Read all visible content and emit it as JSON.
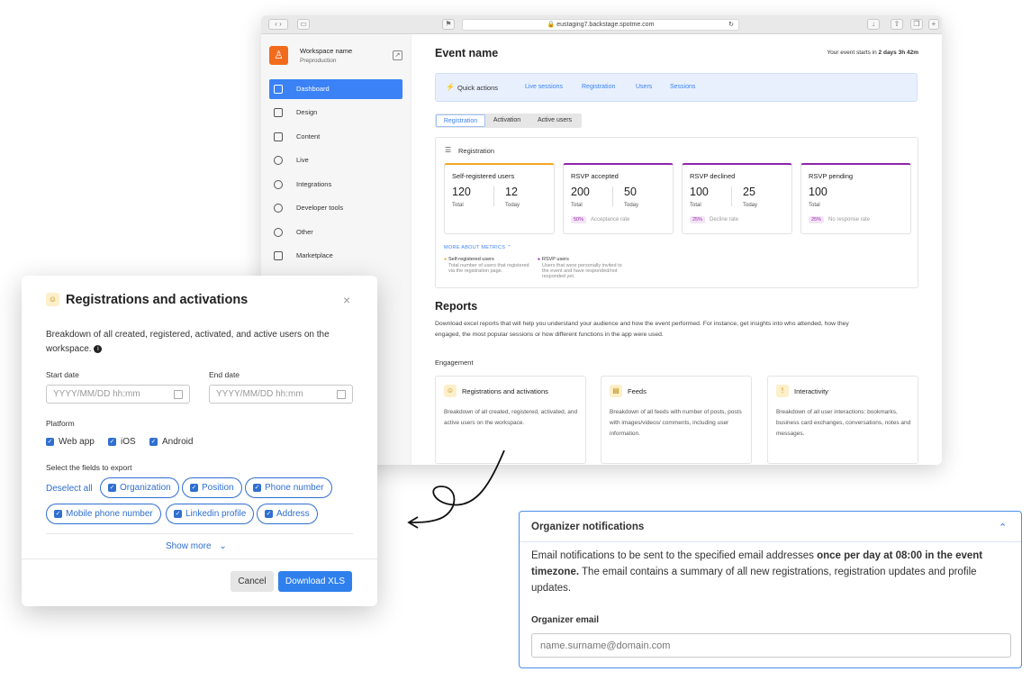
{
  "browser": {
    "url": "eustaging7.backstage.spotme.com"
  },
  "sidebar": {
    "workspace_name": "Workspace name",
    "workspace_sub": "Preproduction",
    "items": [
      {
        "label": "Dashboard"
      },
      {
        "label": "Design"
      },
      {
        "label": "Content"
      },
      {
        "label": "Live"
      },
      {
        "label": "Integrations"
      },
      {
        "label": "Developer tools"
      },
      {
        "label": "Other"
      },
      {
        "label": "Marketplace"
      }
    ]
  },
  "main": {
    "event_name": "Event name",
    "starts_prefix": "Your event starts in",
    "starts_value": "2 days 3h 42m",
    "quick_actions": {
      "label": "Quick actions",
      "links": [
        "Live sessions",
        "Registration",
        "Users",
        "Sessions"
      ]
    },
    "tabs": [
      "Registration",
      "Activation",
      "Active users"
    ],
    "registration": {
      "title": "Registration",
      "cards": [
        {
          "title": "Self-registered users",
          "v1": "120",
          "l1": "Total",
          "v2": "12",
          "l2": "Today"
        },
        {
          "title": "RSVP accepted",
          "v1": "200",
          "l1": "Total",
          "v2": "50",
          "l2": "Today",
          "pct": "50%",
          "rate": "Acceptance rate"
        },
        {
          "title": "RSVP declined",
          "v1": "100",
          "l1": "Total",
          "v2": "25",
          "l2": "Today",
          "pct": "25%",
          "rate": "Decline rate"
        },
        {
          "title": "RSVP pending",
          "v1": "100",
          "l1": "Total",
          "pct": "25%",
          "rate": "No response rate"
        }
      ],
      "more_metrics": "MORE ABOUT METRICS",
      "legend": [
        {
          "title": "Self-registered users",
          "desc1": "Total number of users that registered",
          "desc2": "via the registration page."
        },
        {
          "title": "RSVP users",
          "desc1": "Users that were personally invited to",
          "desc2": "the event and have responded/not",
          "desc3": "responded yet."
        }
      ]
    },
    "reports": {
      "title": "Reports",
      "desc1": "Download excel reports that will help you understand your audience and how the event performed. For instance, get insights into who attended, how they",
      "desc2": "engaged, the most popular sessions or how different functions in the app were used.",
      "section": "Engagement",
      "cards": [
        {
          "title": "Registrations and activations",
          "desc": "Breakdown of all created, registered, activated, and active users on the workspace."
        },
        {
          "title": "Feeds",
          "desc": "Breakdown of all feeds with number of posts, posts with images/videos/ comments, including user information."
        },
        {
          "title": "Interactivity",
          "desc": "Breakdown of all user interactions: bookmarks, business card exchanges, conversations, notes and messages."
        }
      ]
    }
  },
  "modal": {
    "title": "Registrations and activations",
    "desc1": "Breakdown of all created, registered, activated, and active users on the",
    "desc2": "workspace.",
    "start_label": "Start date",
    "end_label": "End date",
    "date_placeholder": "YYYY/MM/DD hh:mm",
    "platform_label": "Platform",
    "platforms": [
      "Web app",
      "iOS",
      "Android"
    ],
    "fields_label": "Select the fields to export",
    "deselect": "Deselect all",
    "fields": [
      "Organization",
      "Position",
      "Phone number",
      "Mobile phone number",
      "Linkedin profile",
      "Address"
    ],
    "show_more": "Show more",
    "cancel": "Cancel",
    "download": "Download XLS"
  },
  "organizer": {
    "title": "Organizer notifications",
    "text_a": "Email notifications to be sent to the specified email addresses ",
    "text_bold": "once per day at 08:00 in the event timezone.",
    "text_b": " The email contains a summary of all new registrations, registration updates and profile updates.",
    "email_label": "Organizer email",
    "email_placeholder": "name.surname@domain.com"
  },
  "colors": {
    "accent": "#3b82f6",
    "orange": "#f26b1d",
    "purple": "#8e24aa",
    "modal_blue": "#2f6fd0"
  }
}
